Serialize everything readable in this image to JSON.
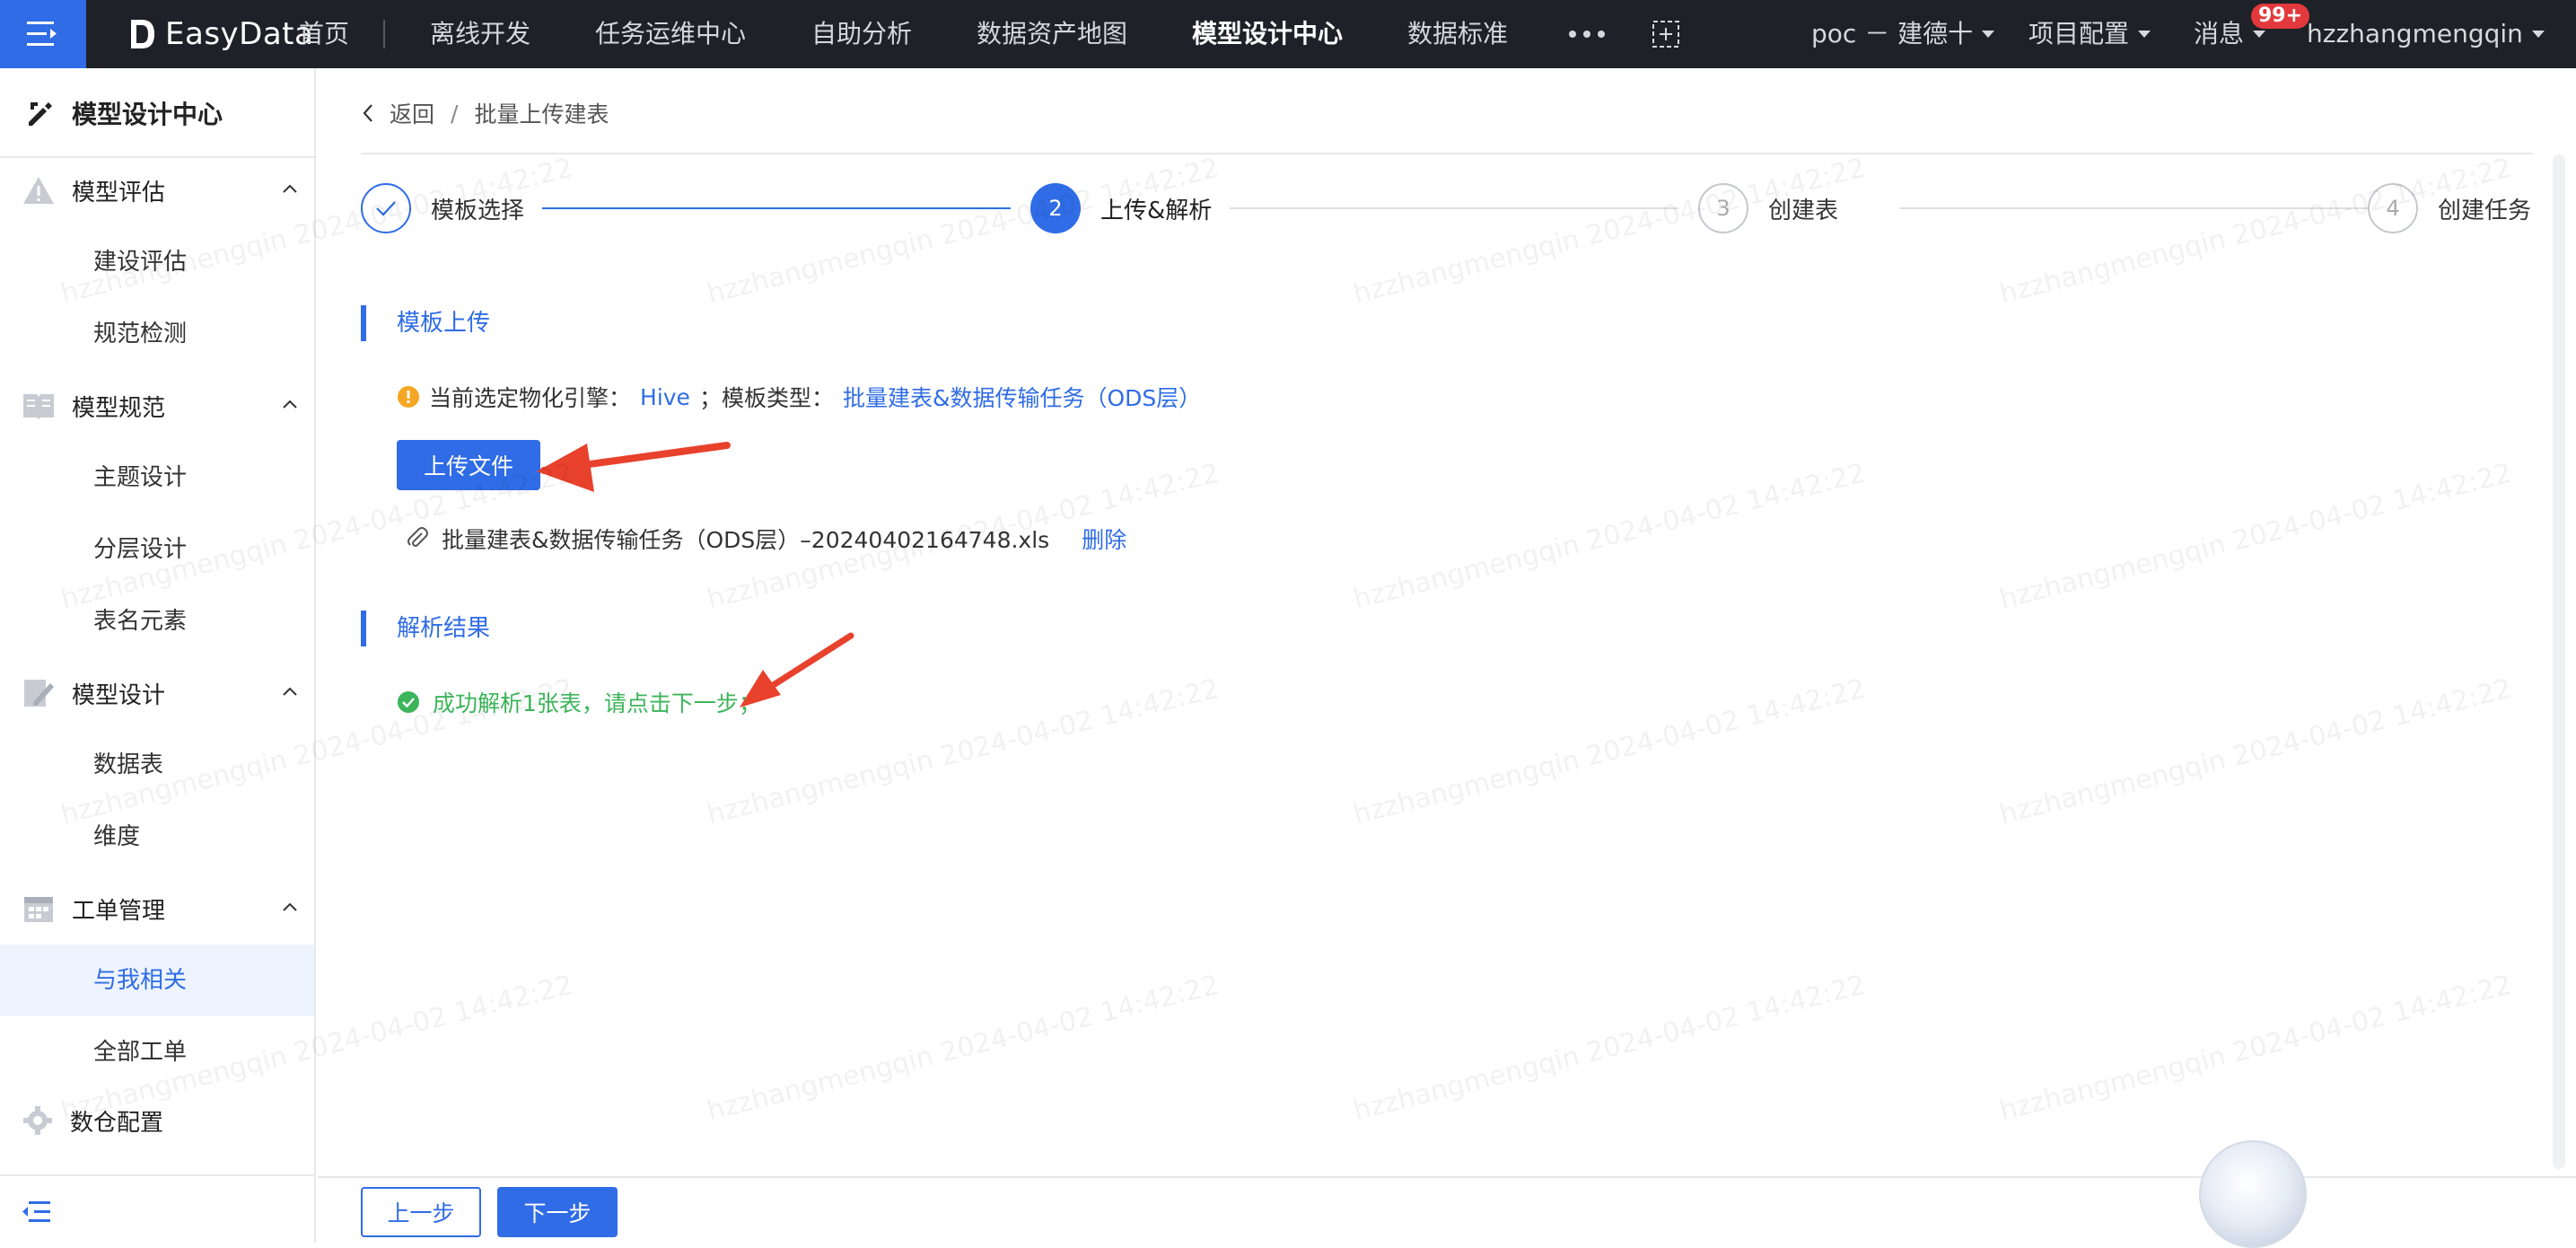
{
  "app": {
    "logo_text": "EasyData"
  },
  "topnav": {
    "items": [
      {
        "label": "首页",
        "active": false
      },
      {
        "label": "离线开发",
        "active": false
      },
      {
        "label": "任务运维中心",
        "active": false
      },
      {
        "label": "自助分析",
        "active": false
      },
      {
        "label": "数据资产地图",
        "active": false
      },
      {
        "label": "模型设计中心",
        "active": true
      },
      {
        "label": "数据标准",
        "active": false
      }
    ],
    "more_icon": "ellipsis-icon",
    "expand_icon": "expand-square-icon",
    "project": "poc － 建德十",
    "config": "项目配置",
    "messages": "消息",
    "messages_badge": "99+",
    "user": "hzzhangmengqin"
  },
  "sidebar": {
    "title": "模型设计中心",
    "groups": [
      {
        "label": "模型评估",
        "icon": "triangle-warning-icon",
        "items": [
          "建设评估",
          "规范检测"
        ]
      },
      {
        "label": "模型规范",
        "icon": "book-icon",
        "items": [
          "主题设计",
          "分层设计",
          "表名元素"
        ]
      },
      {
        "label": "模型设计",
        "icon": "edit-doc-icon",
        "items": [
          "数据表",
          "维度"
        ]
      },
      {
        "label": "工单管理",
        "icon": "calendar-icon",
        "items": [
          "与我相关",
          "全部工单"
        ]
      }
    ],
    "active_item": "与我相关",
    "bottom_item": {
      "label": "数仓配置",
      "icon": "gear-icon"
    }
  },
  "breadcrumb": {
    "back": "返回",
    "separator": "/",
    "current": "批量上传建表"
  },
  "steps": [
    {
      "label": "模板选择",
      "number": "1",
      "status": "done"
    },
    {
      "label": "上传&解析",
      "number": "2",
      "status": "current"
    },
    {
      "label": "创建表",
      "number": "3",
      "status": "todo"
    },
    {
      "label": "创建任务",
      "number": "4",
      "status": "todo"
    }
  ],
  "upload": {
    "section_title": "模板上传",
    "notice_prefix": "当前选定物化引擎：",
    "engine": "Hive",
    "notice_mid": "；模板类型：",
    "template_type": "批量建表&数据传输任务（ODS层）",
    "button": "上传文件",
    "file_name": "批量建表&数据传输任务（ODS层）–20240402164748.xls",
    "delete": "删除"
  },
  "result": {
    "section_title": "解析结果",
    "message": "成功解析1张表，请点击下一步；"
  },
  "footer": {
    "prev": "上一步",
    "next": "下一步"
  },
  "watermark": "hzzhangmengqin 2024-04-02 14:42:22",
  "colors": {
    "primary": "#2f6ce6",
    "topbar": "#1f2128",
    "success": "#3cb55a",
    "warning": "#f5a623",
    "annotation_arrow": "#e8412c"
  }
}
